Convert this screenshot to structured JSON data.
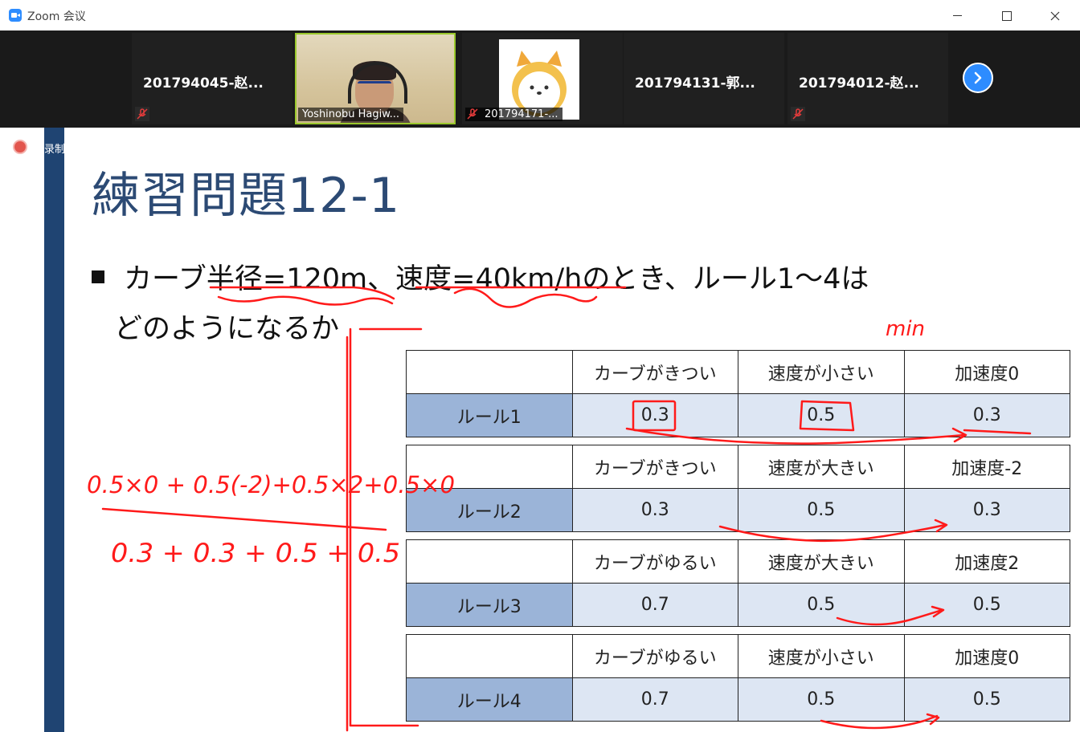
{
  "window": {
    "title": "Zoom 会议"
  },
  "participants": [
    {
      "name": "201794045-赵...",
      "video": false,
      "muted": true
    },
    {
      "name": "Yoshinobu Hagiw...",
      "video": true,
      "muted": false
    },
    {
      "name": "201794171-...",
      "video": false,
      "avatar": true,
      "muted": true
    },
    {
      "name": "201794131-郭...",
      "video": false,
      "muted": false
    },
    {
      "name": "201794012-赵...",
      "video": false,
      "muted": true
    }
  ],
  "recording": {
    "label": "录制"
  },
  "slide": {
    "title": "練習問題12-1",
    "bullet_line1": "カーブ半径=120m、速度=40km/hのとき、ルール1〜4は",
    "bullet_line2": "どのようになるか"
  },
  "rules": [
    {
      "headers": [
        "カーブがきつい",
        "速度が小さい",
        "加速度0"
      ],
      "name": "ルール1",
      "values": [
        "0.3",
        "0.5",
        "0.3"
      ]
    },
    {
      "headers": [
        "カーブがきつい",
        "速度が大きい",
        "加速度-2"
      ],
      "name": "ルール2",
      "values": [
        "0.3",
        "0.5",
        "0.3"
      ]
    },
    {
      "headers": [
        "カーブがゆるい",
        "速度が大きい",
        "加速度2"
      ],
      "name": "ルール3",
      "values": [
        "0.7",
        "0.5",
        "0.5"
      ]
    },
    {
      "headers": [
        "カーブがゆるい",
        "速度が小さい",
        "加速度0"
      ],
      "name": "ルール4",
      "values": [
        "0.7",
        "0.5",
        "0.5"
      ]
    }
  ],
  "annotations": {
    "min_label": "min",
    "numerator": "0.5×0 + 0.5(-2)+0.5×2+0.5×0",
    "denominator": "0.3 + 0.3 + 0.5 + 0.5"
  },
  "colors": {
    "ink": "#ff1a1a",
    "zoom_blue": "#2D8CFF",
    "slide_bar": "#1f4472",
    "rule_cell": "#9bb4d8",
    "value_cell": "#dde6f3"
  }
}
